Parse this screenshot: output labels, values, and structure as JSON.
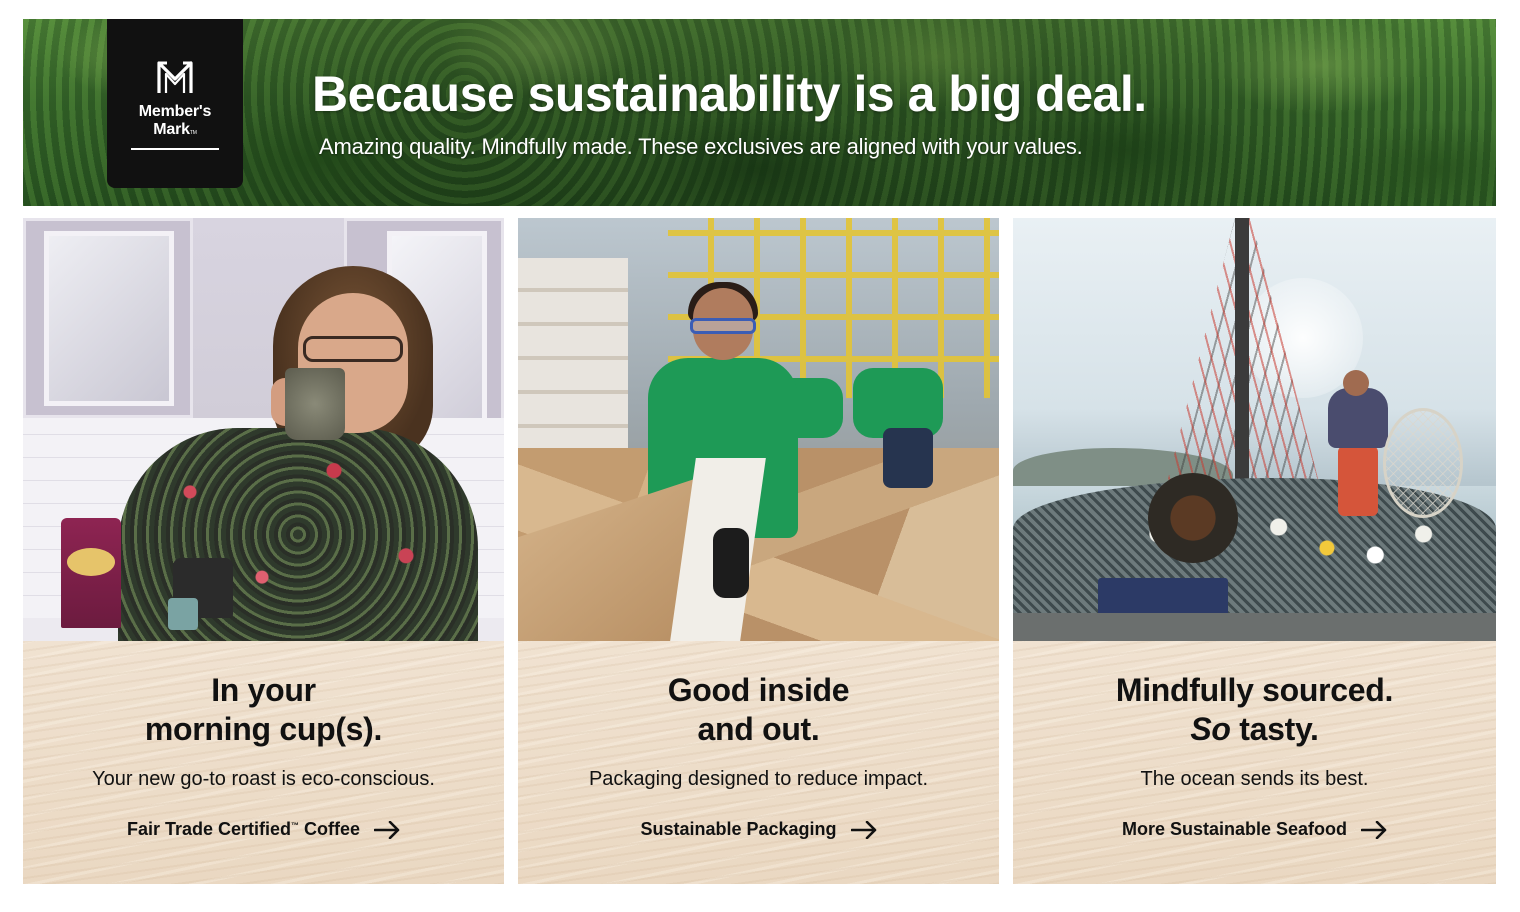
{
  "brand": {
    "name_line1": "Member's",
    "name_line2": "Mark",
    "trademark": "TM"
  },
  "hero": {
    "headline": "Because sustainability is a big deal.",
    "subheadline": "Amazing quality. Mindfully made. These exclusives are aligned with your values."
  },
  "cards": [
    {
      "title_line1": "In your",
      "title_line2": "morning cup(s).",
      "description": "Your new go-to roast is eco-conscious.",
      "link_label": "Fair Trade Certified",
      "link_tm": "™",
      "link_suffix": " Coffee",
      "link_icon": "arrow-right-icon"
    },
    {
      "title_line1": "Good inside",
      "title_line2": "and out.",
      "description": "Packaging designed to reduce impact.",
      "link_label": "Sustainable Packaging",
      "link_icon": "arrow-right-icon"
    },
    {
      "title_line1": "Mindfully sourced.",
      "title_line2_italic": "So",
      "title_line2_rest": " tasty.",
      "description": "The ocean sends its best.",
      "link_label": "More Sustainable Seafood",
      "link_icon": "arrow-right-icon"
    }
  ],
  "colors": {
    "text": "#111111",
    "card_panel": "#ecdcc8",
    "logo_bg": "#111111",
    "hero_green": "#3e7330"
  }
}
